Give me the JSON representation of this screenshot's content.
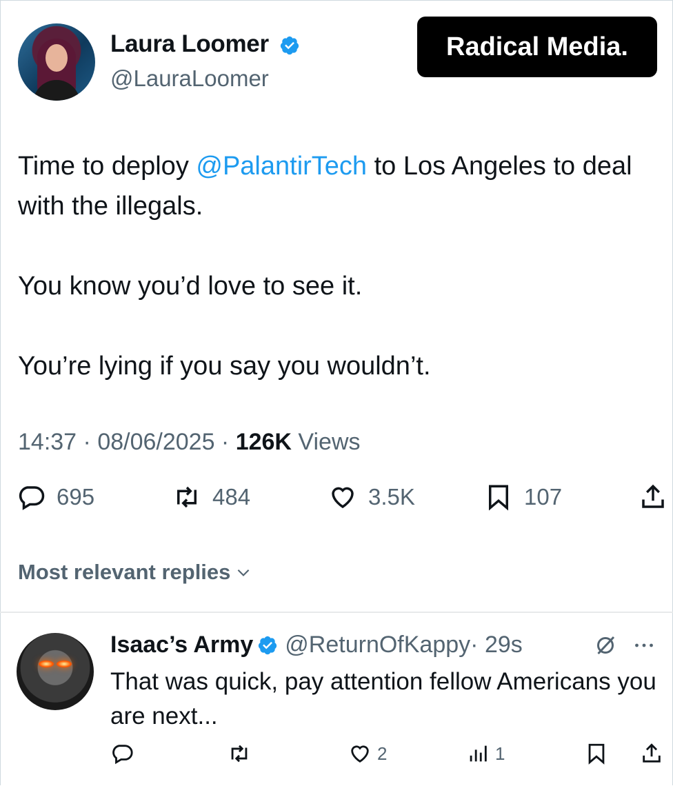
{
  "tweet": {
    "author_name": "Laura Loomer",
    "author_handle": "@LauraLoomer",
    "line1_before": "Time to deploy ",
    "mention": "@PalantirTech",
    "line1_after": " to Los Angeles to deal with the illegals.",
    "para2": "You know you’d love to see it.",
    "para3": "You’re lying if you say you wouldn’t.",
    "time": "14:37",
    "sep": " · ",
    "date": "08/06/2025",
    "views_count": "126K",
    "views_label": " Views"
  },
  "badge": {
    "text": "Radical Media."
  },
  "actions": {
    "replies": "695",
    "reposts": "484",
    "likes": "3.5K",
    "bookmarks": "107"
  },
  "replies_sort": {
    "label": "Most relevant replies"
  },
  "reply": {
    "author_name": "Isaac’s Army",
    "author_handle": "@ReturnOfKappy",
    "time": " · 29s",
    "text": "That was quick, pay attention fellow Americans you are next...",
    "likes": "2",
    "views": "1"
  },
  "colors": {
    "accent": "#1d9bf0",
    "muted": "#536471",
    "text": "#0f1419"
  },
  "icons": [
    "verified-icon",
    "reply-icon",
    "repost-icon",
    "like-icon",
    "bookmark-icon",
    "share-icon",
    "chevron-down-icon",
    "grok-icon",
    "more-icon",
    "views-icon"
  ]
}
